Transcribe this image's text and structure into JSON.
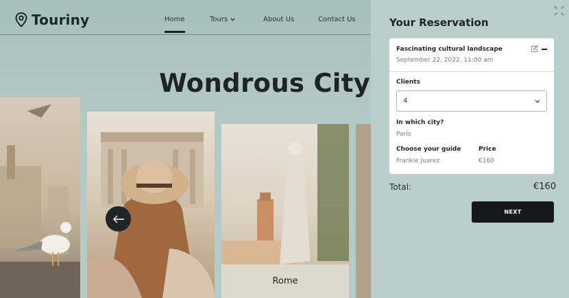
{
  "brand": {
    "name": "Touriny",
    "icon": "map-pin-icon"
  },
  "nav": {
    "items": [
      {
        "label": "Home",
        "active": true
      },
      {
        "label": "Tours",
        "has_dropdown": true
      },
      {
        "label": "About Us"
      },
      {
        "label": "Contact Us"
      }
    ]
  },
  "hero": {
    "title": "Wondrous City To"
  },
  "carousel": {
    "cards": [
      {
        "label": ""
      },
      {
        "label": ""
      },
      {
        "label": "Rome"
      }
    ],
    "prev_icon": "arrow-left-icon"
  },
  "reservation": {
    "title": "Your Reservation",
    "tour_name": "Fascinating cultural landscape",
    "tour_date": "September 22, 2022, 11:00 am",
    "clients_label": "Clients",
    "clients_value": "4",
    "city_label": "In which city?",
    "city_value": "Paris",
    "guide_label": "Choose your guide",
    "guide_value": "Frankie Juarez",
    "price_label": "Price",
    "price_value": "€160",
    "total_label": "Total:",
    "total_value": "€160",
    "next_label": "NEXT",
    "icons": {
      "close": "close-icon",
      "edit": "edit-icon",
      "collapse": "minus-icon",
      "dropdown": "chevron-down-icon"
    }
  },
  "colors": {
    "panel_bg": "#bacfcc",
    "button_bg": "#151718",
    "text_dark": "#1f2527"
  }
}
